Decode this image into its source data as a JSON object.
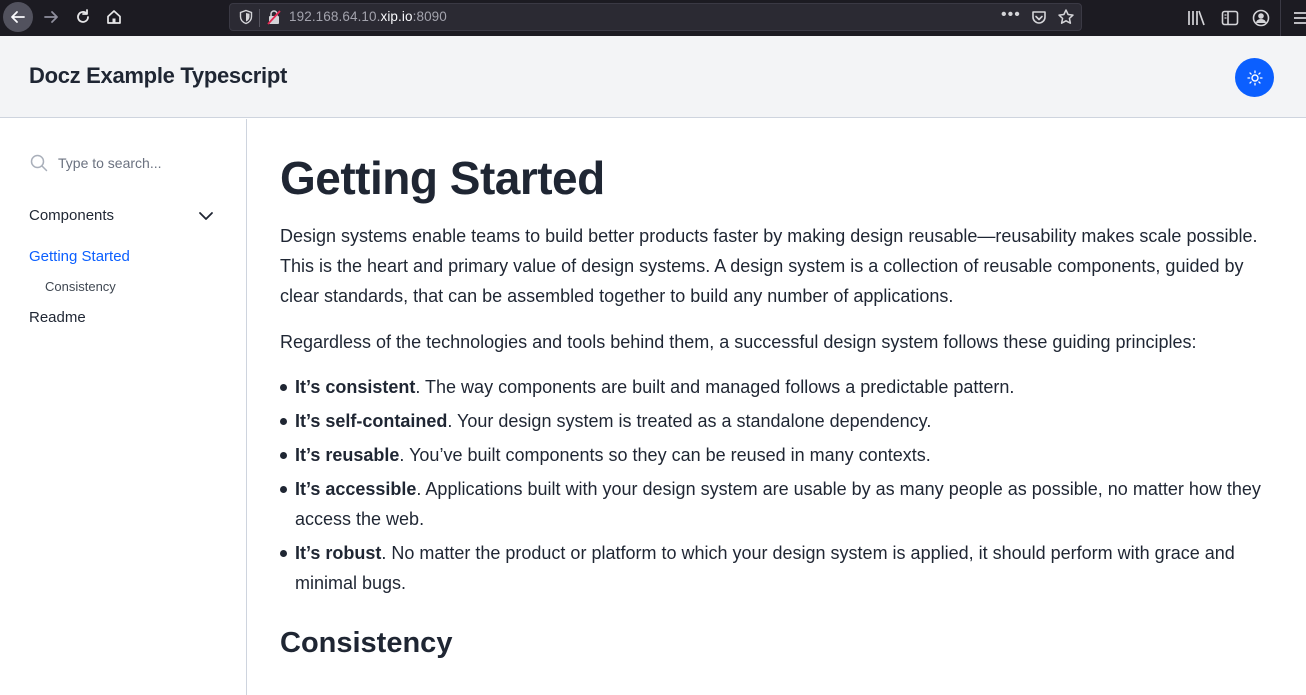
{
  "browser": {
    "url_prefix": "192.168.64.10.",
    "url_host": "xip.io",
    "url_port": ":8090",
    "more_label": "•••",
    "icons": [
      "back-arrow-icon",
      "forward-arrow-icon",
      "reload-icon",
      "home-icon",
      "shield-icon",
      "insecure-lock-icon",
      "pocket-icon",
      "bookmark-star-icon",
      "library-icon",
      "sidebar-icon",
      "account-icon",
      "hamburger-menu-icon"
    ]
  },
  "header": {
    "title": "Docz Example Typescript",
    "theme_toggle_icon": "sun-icon",
    "accent_color": "#0b5fff"
  },
  "sidebar": {
    "search_placeholder": "Type to search...",
    "group": {
      "label": "Components",
      "expanded": true
    },
    "items": [
      {
        "label": "Getting Started",
        "active": true
      },
      {
        "label": "Consistency",
        "sub": true
      },
      {
        "label": "Readme"
      }
    ]
  },
  "main": {
    "title": "Getting Started",
    "intro": "Design systems enable teams to build better products faster by making design reusable—reusability makes scale possible. This is the heart and primary value of design systems. A design system is a collection of reusable components, guided by clear standards, that can be assembled together to build any number of applications.",
    "principles_intro": "Regardless of the technologies and tools behind them, a successful design system follows these guiding principles:",
    "principles": [
      {
        "bold": "It’s consistent",
        "text": ". The way components are built and managed follows a predictable pattern."
      },
      {
        "bold": "It’s self-contained",
        "text": ". Your design system is treated as a standalone dependency."
      },
      {
        "bold": "It’s reusable",
        "text": ". You’ve built components so they can be reused in many contexts."
      },
      {
        "bold": "It’s accessible",
        "text": ". Applications built with your design system are usable by as many people as possible, no matter how they access the web."
      },
      {
        "bold": "It’s robust",
        "text": ". No matter the product or platform to which your design system is applied, it should perform with grace and minimal bugs."
      }
    ],
    "section_heading": "Consistency"
  }
}
